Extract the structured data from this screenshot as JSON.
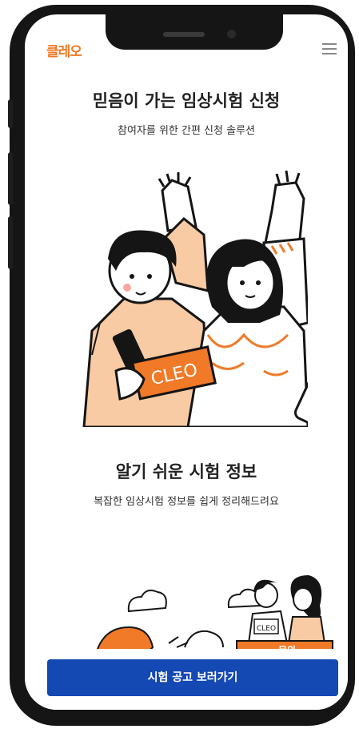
{
  "header": {
    "logo_text": "클레오",
    "menu_icon": "hamburger-menu-icon"
  },
  "section1": {
    "title": "믿음이 가는 임상시험 신청",
    "subtitle": "참여자를 위한 간편 신청 솔루션",
    "illustration_sign_text": "CLEO"
  },
  "section2": {
    "title": "알기 쉬운 시험 정보",
    "subtitle": "복잡한 임상시험 정보를 쉽게 정리해드려요"
  },
  "section3": {
    "sign_text": "CLEO",
    "badge_text": "문의"
  },
  "cta": {
    "label": "시험 공고 보러가기"
  },
  "colors": {
    "brand": "#f07a28",
    "cta": "#1448b3",
    "skin": "#f9cba4",
    "dark": "#151515"
  }
}
